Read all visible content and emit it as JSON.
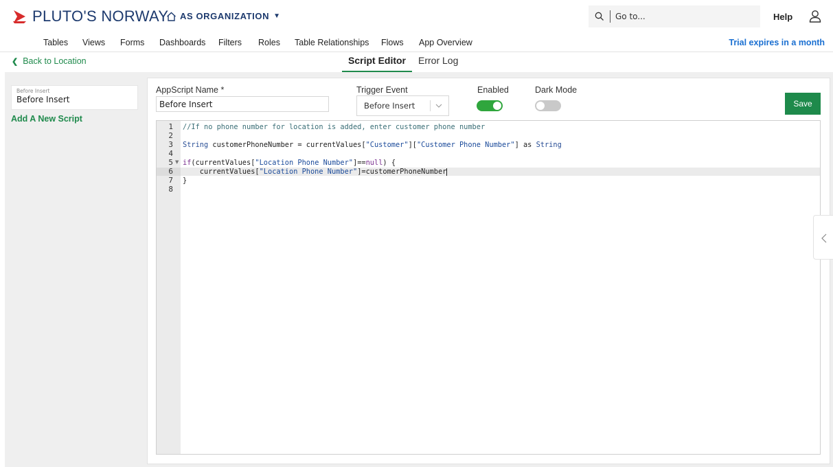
{
  "header": {
    "brand": "PLUTO'S NORWAY",
    "org": "AS ORGANIZATION",
    "search_placeholder": "Go to...",
    "help": "Help"
  },
  "nav": {
    "items": [
      "Tables",
      "Views",
      "Forms",
      "Dashboards",
      "Filters",
      "Roles",
      "Table Relationships",
      "Flows",
      "App Overview"
    ],
    "trial": "Trial expires in a month"
  },
  "subnav": {
    "back": "Back to Location",
    "tabs": [
      "Script Editor",
      "Error Log"
    ],
    "active_tab": "Script Editor"
  },
  "sidebar": {
    "scripts": [
      {
        "caption": "Before Insert",
        "name": "Before Insert"
      }
    ],
    "add_new": "Add A New Script"
  },
  "form": {
    "name_label": "AppScript Name *",
    "name_value": "Before Insert",
    "trigger_label": "Trigger Event",
    "trigger_value": "Before Insert",
    "enabled_label": "Enabled",
    "enabled": true,
    "dark_mode_label": "Dark Mode",
    "dark_mode": false,
    "save": "Save"
  },
  "editor": {
    "line_numbers": [
      "1",
      "2",
      "3",
      "4",
      "5",
      "6",
      "7",
      "8"
    ],
    "active_line": 6,
    "lines": [
      "//If no phone number for location is added, enter customer phone number",
      "",
      "String customerPhoneNumber = currentValues[\"Customer\"][\"Customer Phone Number\"] as String",
      "",
      "if(currentValues[\"Location Phone Number\"]==null) {",
      "    currentValues[\"Location Phone Number\"]=customerPhoneNumber",
      "}",
      ""
    ]
  },
  "colors": {
    "brand": "#1d3a6e",
    "accent": "#1f8a4c",
    "link": "#1a6fd1",
    "toggle_on": "#2fa63d",
    "toggle_off": "#c9c9c9"
  },
  "icons": [
    "ship-logo-icon",
    "home-icon",
    "search-icon",
    "user-icon",
    "chevron-left-icon",
    "chevron-down-icon",
    "fold-arrow-icon"
  ]
}
